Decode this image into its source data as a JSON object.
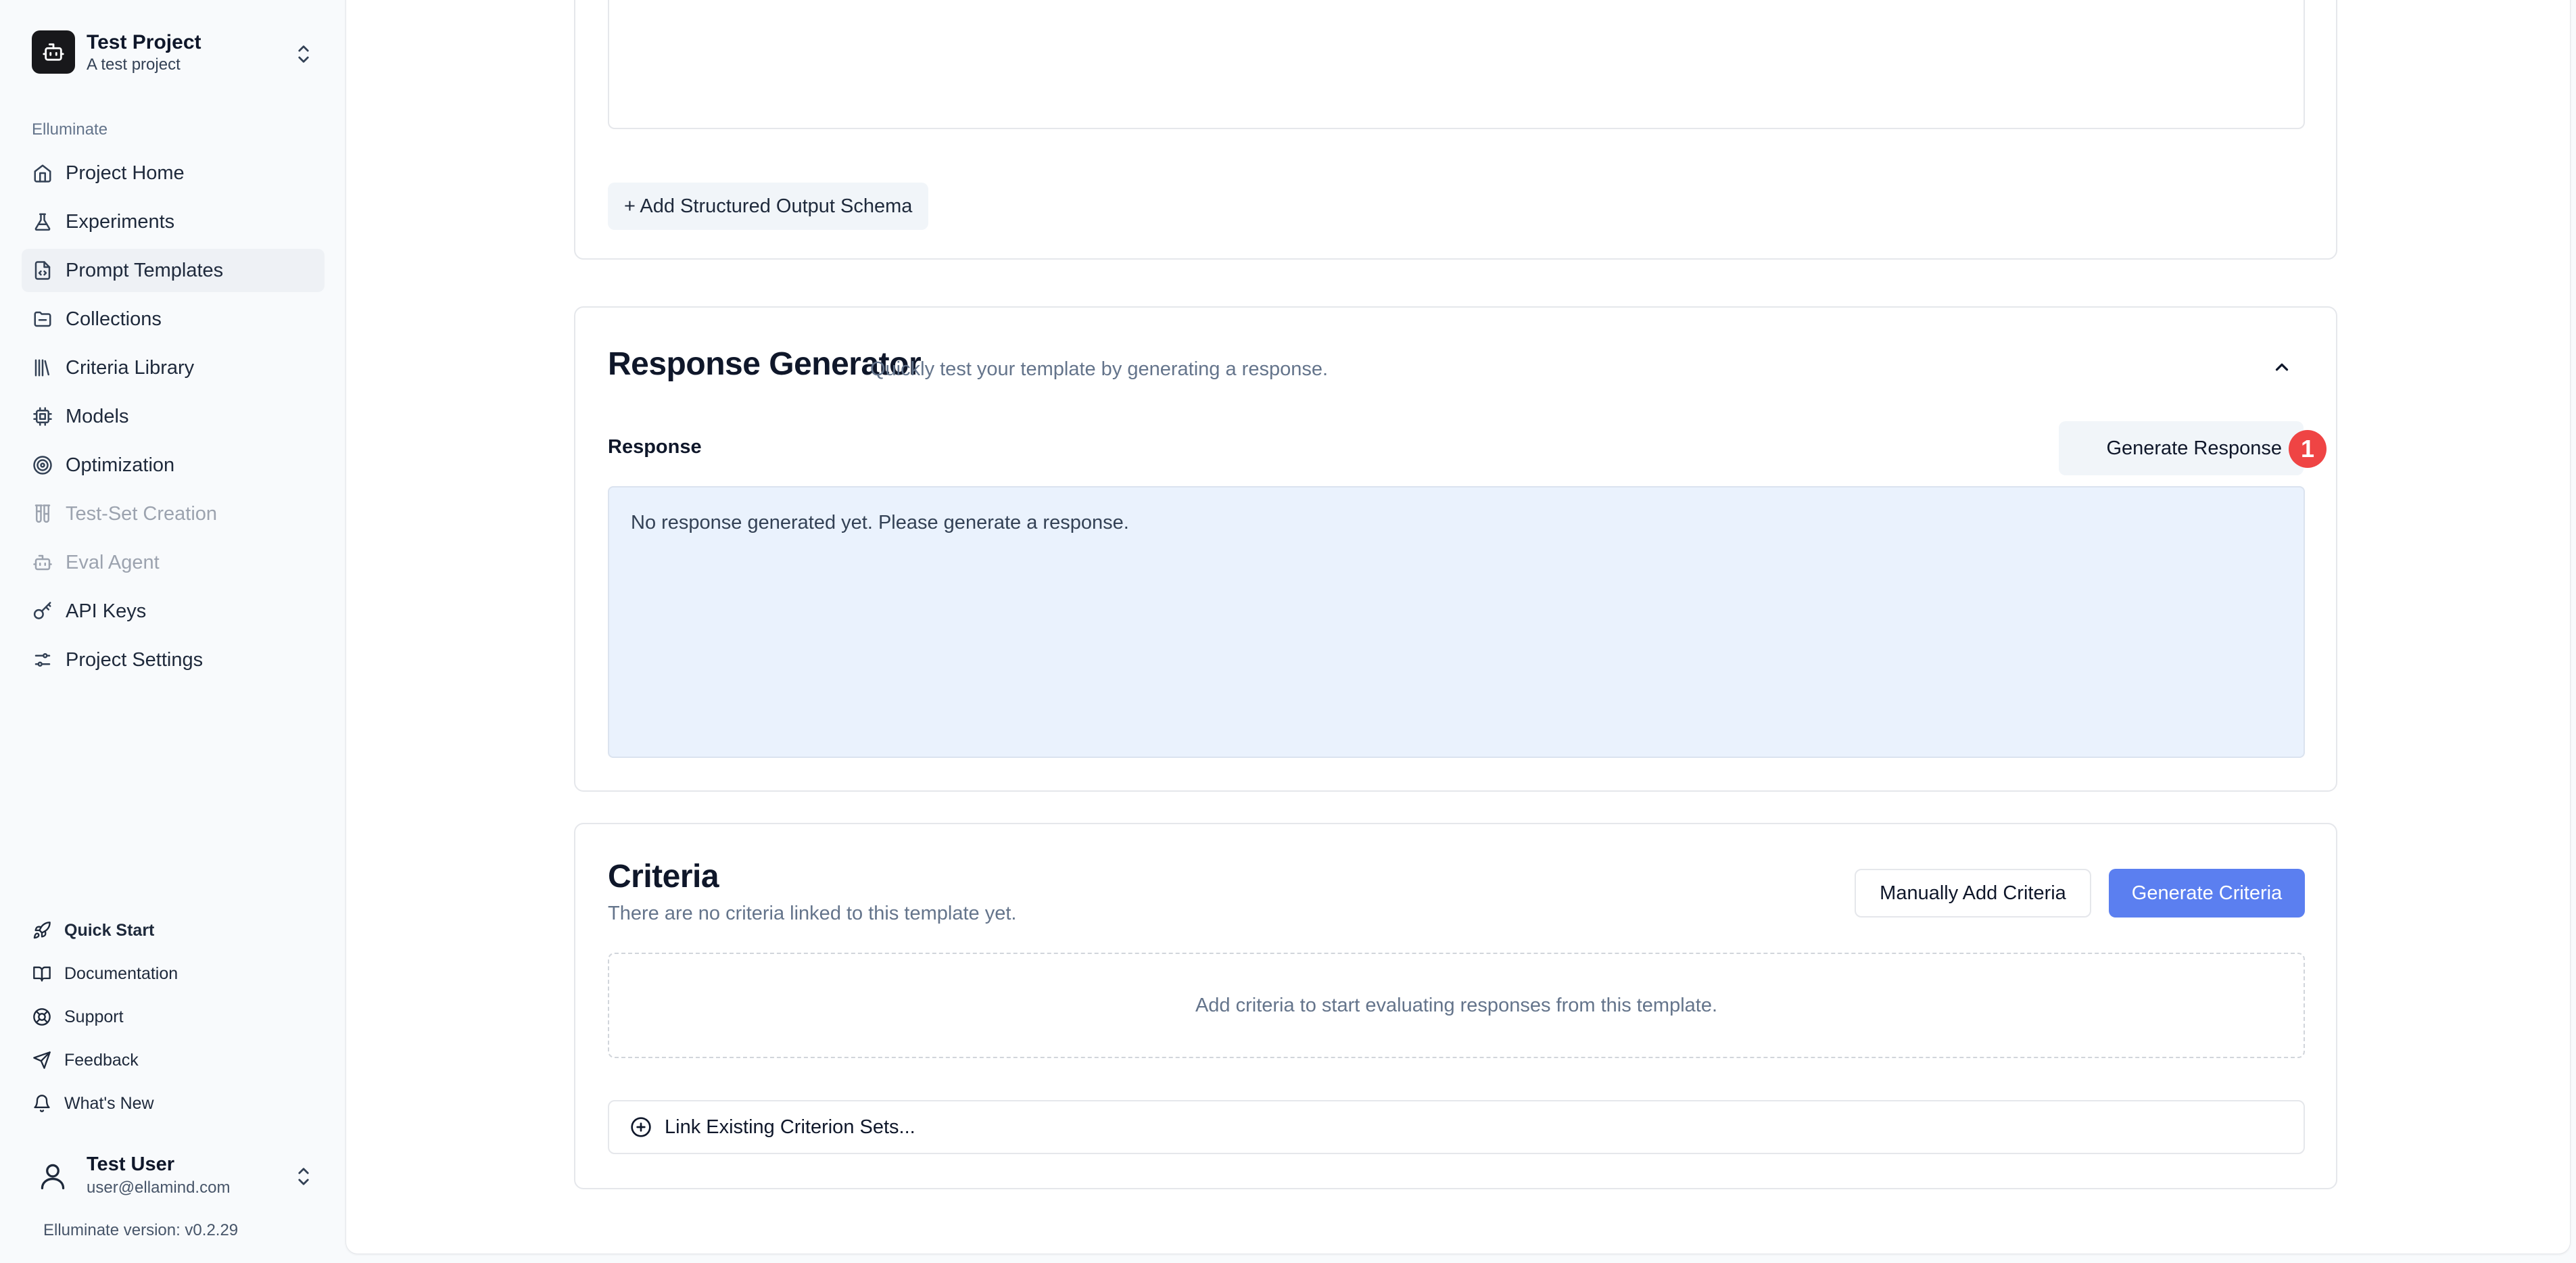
{
  "project": {
    "name": "Test Project",
    "description": "A test project"
  },
  "sidebar": {
    "section_label": "Elluminate",
    "items": [
      {
        "label": "Project Home",
        "icon": "home-icon",
        "active": false,
        "disabled": false
      },
      {
        "label": "Experiments",
        "icon": "flask-icon",
        "active": false,
        "disabled": false
      },
      {
        "label": "Prompt Templates",
        "icon": "file-code-icon",
        "active": true,
        "disabled": false
      },
      {
        "label": "Collections",
        "icon": "folder-icon",
        "active": false,
        "disabled": false
      },
      {
        "label": "Criteria Library",
        "icon": "library-icon",
        "active": false,
        "disabled": false
      },
      {
        "label": "Models",
        "icon": "cpu-icon",
        "active": false,
        "disabled": false
      },
      {
        "label": "Optimization",
        "icon": "target-icon",
        "active": false,
        "disabled": false
      },
      {
        "label": "Test-Set Creation",
        "icon": "test-tubes-icon",
        "active": false,
        "disabled": true
      },
      {
        "label": "Eval Agent",
        "icon": "bot-icon",
        "active": false,
        "disabled": true
      },
      {
        "label": "API Keys",
        "icon": "key-icon",
        "active": false,
        "disabled": false
      },
      {
        "label": "Project Settings",
        "icon": "settings-sliders-icon",
        "active": false,
        "disabled": false
      }
    ],
    "footer_items": [
      {
        "label": "Quick Start",
        "icon": "rocket-icon"
      },
      {
        "label": "Documentation",
        "icon": "book-icon"
      },
      {
        "label": "Support",
        "icon": "life-buoy-icon"
      },
      {
        "label": "Feedback",
        "icon": "send-icon"
      },
      {
        "label": "What's New",
        "icon": "bell-icon"
      }
    ]
  },
  "user": {
    "name": "Test User",
    "email": "user@ellamind.com"
  },
  "version_text": "Elluminate version: v0.2.29",
  "schema_section": {
    "add_schema_label": "+ Add Structured Output Schema"
  },
  "response_generator": {
    "title": "Response Generator",
    "subtitle": "Quickly test your template by generating a response.",
    "response_label": "Response",
    "generate_label": "Generate Response",
    "badge": "1",
    "placeholder": "No response generated yet. Please generate a response."
  },
  "criteria": {
    "title": "Criteria",
    "subtitle": "There are no criteria linked to this template yet.",
    "manual_add_label": "Manually Add Criteria",
    "generate_label": "Generate Criteria",
    "empty_text": "Add criteria to start evaluating responses from this template.",
    "link_existing_label": "Link Existing Criterion Sets..."
  },
  "colors": {
    "primary": "#5b7ff0",
    "badge": "#ef4444",
    "response_bg": "#eaf2fd",
    "sidebar_active_bg": "#eef1f5"
  }
}
